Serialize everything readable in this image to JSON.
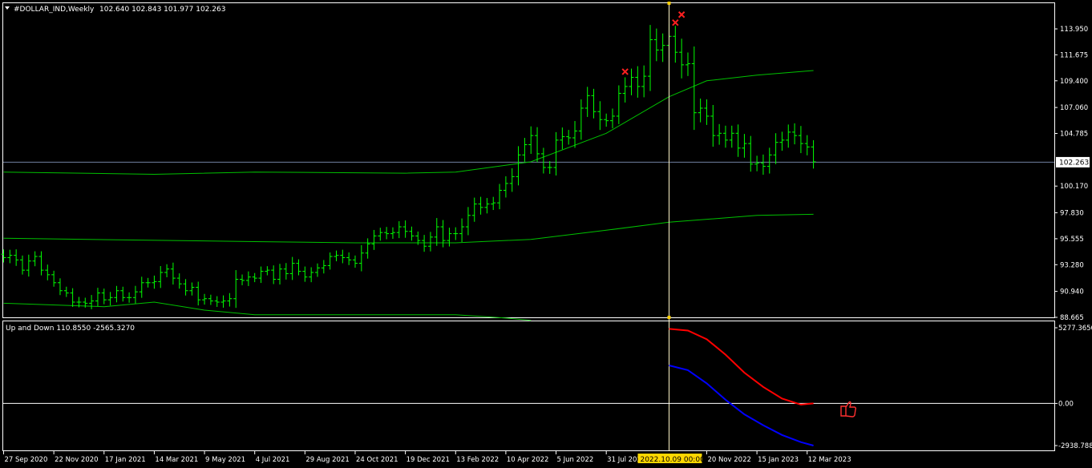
{
  "main_pane": {
    "symbol_label": "#DOLLAR_IND,Weekly",
    "ohlc_label": "102.640 102.843 101.977 102.263",
    "price_axis_labels": [
      "113.950",
      "111.675",
      "109.400",
      "107.060",
      "104.785",
      "102.263",
      "100.170",
      "97.830",
      "95.555",
      "93.280",
      "90.940",
      "88.665"
    ],
    "current_price_label": "102.263"
  },
  "indicator_pane": {
    "title": "Up and Down 110.8550 -2565.3270",
    "axis_labels": [
      "5277.3656",
      "0.00",
      "-2938.7880"
    ]
  },
  "time_axis": {
    "labels": [
      "27 Sep 2020",
      "22 Nov 2020",
      "17 Jan 2021",
      "14 Mar 2021",
      "9 May 2021",
      "4 Jul 2021",
      "29 Aug 2021",
      "24 Oct 2021",
      "19 Dec 2021",
      "13 Feb 2022",
      "10 Apr 2022",
      "5 Jun 2022",
      "31 Jul 2022",
      "20 Nov 2022",
      "15 Jan 2023",
      "12 Mar 2023"
    ],
    "crosshair_label": "2022.10.09 00:00"
  },
  "colors": {
    "background": "#000000",
    "frame": "#ffffff",
    "bars": "#00ff00",
    "bands": "#00c000",
    "up_line": "#ff0000",
    "down_line": "#0000ff",
    "crosshair": "#fff5c8",
    "signal_marker": "#ff2020",
    "price_label_bg": "#ffffff",
    "crosshair_label_bg": "#ffd700"
  },
  "chart_data": [
    {
      "type": "ohlc",
      "title": "#DOLLAR_IND,Weekly",
      "ylim": [
        88.665,
        116.2
      ],
      "x": [
        "2020-09-27",
        "2020-10-04",
        "2020-10-11",
        "2020-10-18",
        "2020-10-25",
        "2020-11-01",
        "2020-11-08",
        "2020-11-15",
        "2020-11-22",
        "2020-11-29",
        "2020-12-06",
        "2020-12-13",
        "2020-12-20",
        "2020-12-27",
        "2021-01-03",
        "2021-01-10",
        "2021-01-17",
        "2021-01-24",
        "2021-01-31",
        "2021-02-07",
        "2021-02-14",
        "2021-02-21",
        "2021-02-28",
        "2021-03-07",
        "2021-03-14",
        "2021-03-21",
        "2021-03-28",
        "2021-04-04",
        "2021-04-11",
        "2021-04-18",
        "2021-04-25",
        "2021-05-02",
        "2021-05-09",
        "2021-05-16",
        "2021-05-23",
        "2021-05-30",
        "2021-06-06",
        "2021-06-13",
        "2021-06-20",
        "2021-06-27",
        "2021-07-04",
        "2021-07-11",
        "2021-07-18",
        "2021-07-25",
        "2021-08-01",
        "2021-08-08",
        "2021-08-15",
        "2021-08-22",
        "2021-08-29",
        "2021-09-05",
        "2021-09-12",
        "2021-09-19",
        "2021-09-26",
        "2021-10-03",
        "2021-10-10",
        "2021-10-17",
        "2021-10-24",
        "2021-10-31",
        "2021-11-07",
        "2021-11-14",
        "2021-11-21",
        "2021-11-28",
        "2021-12-05",
        "2021-12-12",
        "2021-12-19",
        "2021-12-26",
        "2022-01-02",
        "2022-01-09",
        "2022-01-16",
        "2022-01-23",
        "2022-01-30",
        "2022-02-06",
        "2022-02-13",
        "2022-02-20",
        "2022-02-27",
        "2022-03-06",
        "2022-03-13",
        "2022-03-20",
        "2022-03-27",
        "2022-04-03",
        "2022-04-10",
        "2022-04-17",
        "2022-04-24",
        "2022-05-01",
        "2022-05-08",
        "2022-05-15",
        "2022-05-22",
        "2022-05-29",
        "2022-06-05",
        "2022-06-12",
        "2022-06-19",
        "2022-06-26",
        "2022-07-03",
        "2022-07-10",
        "2022-07-17",
        "2022-07-24",
        "2022-07-31",
        "2022-08-07",
        "2022-08-14",
        "2022-08-21",
        "2022-08-28",
        "2022-09-04",
        "2022-09-11",
        "2022-09-18",
        "2022-09-25",
        "2022-10-02",
        "2022-10-09",
        "2022-10-16",
        "2022-10-23",
        "2022-10-30",
        "2022-11-06",
        "2022-11-13",
        "2022-11-20",
        "2022-11-27",
        "2022-12-04",
        "2022-12-11",
        "2022-12-18",
        "2022-12-25",
        "2023-01-01",
        "2023-01-08",
        "2023-01-15",
        "2023-01-22",
        "2023-01-29",
        "2023-02-05",
        "2023-02-12",
        "2023-02-19",
        "2023-02-26",
        "2023-03-05",
        "2023-03-12",
        "2023-03-19"
      ],
      "close": [
        93.9,
        94.1,
        93.7,
        92.8,
        93.6,
        94.0,
        92.8,
        92.4,
        91.7,
        91.0,
        90.8,
        90.0,
        90.0,
        89.9,
        90.1,
        90.8,
        90.2,
        90.4,
        91.0,
        90.4,
        90.4,
        90.9,
        91.7,
        91.7,
        91.8,
        92.6,
        92.9,
        92.1,
        91.6,
        91.0,
        91.3,
        90.2,
        90.3,
        90.1,
        90.0,
        90.1,
        90.3,
        92.0,
        91.9,
        92.2,
        92.1,
        92.7,
        92.8,
        92.0,
        92.9,
        92.5,
        93.4,
        92.7,
        92.2,
        92.6,
        93.0,
        93.2,
        94.0,
        94.1,
        93.9,
        93.7,
        93.4,
        94.3,
        95.1,
        95.8,
        96.1,
        96.0,
        96.1,
        96.6,
        96.2,
        95.8,
        95.4,
        94.9,
        95.7,
        96.6,
        95.4,
        96.0,
        96.0,
        96.6,
        97.6,
        98.6,
        98.3,
        98.6,
        98.7,
        99.8,
        100.4,
        101.0,
        102.9,
        103.8,
        104.6,
        103.0,
        101.8,
        101.8,
        104.2,
        104.5,
        104.4,
        105.0,
        107.0,
        108.1,
        106.7,
        106.0,
        105.9,
        106.3,
        108.3,
        108.9,
        109.7,
        108.9,
        109.8,
        113.0,
        112.1,
        112.5,
        113.3,
        111.9,
        110.8,
        110.9,
        106.6,
        107.0,
        106.3,
        104.6,
        104.8,
        104.2,
        104.8,
        103.5,
        103.9,
        102.1,
        102.2,
        101.9,
        102.9,
        104.0,
        104.2,
        104.9,
        104.6,
        103.9,
        103.6,
        102.3
      ],
      "range": [
        1.2,
        1.4,
        1.5,
        1.1,
        1.6,
        1.3,
        1.3,
        1.4,
        1.0,
        1.1,
        1.0,
        1.2,
        1.3,
        1.1,
        1.5,
        1.3,
        1.1,
        1.4,
        1.2,
        1.0,
        1.3,
        1.5,
        1.5,
        1.2,
        1.5,
        1.6,
        1.2,
        1.6,
        1.2,
        1.2,
        1.2,
        1.4,
        1.2,
        1.0,
        1.2,
        1.4,
        1.4,
        2.3,
        1.2,
        1.4,
        1.0,
        1.2,
        1.0,
        1.2,
        1.3,
        1.5,
        1.6,
        1.0,
        1.2,
        1.3,
        1.1,
        1.4,
        1.0,
        1.2,
        1.4,
        1.3,
        1.1,
        2.0,
        1.4,
        1.5,
        1.2,
        1.4,
        1.3,
        1.4,
        1.6,
        1.2,
        1.1,
        1.4,
        1.3,
        2.2,
        1.7,
        1.5,
        1.6,
        2.1,
        2.1,
        1.6,
        1.8,
        1.5,
        1.5,
        1.6,
        1.8,
        2.1,
        2.2,
        1.7,
        2.3,
        2.1,
        1.5,
        1.6,
        2.0,
        2.3,
        1.7,
        2.5,
        2.2,
        2.2,
        1.7,
        2.6,
        1.5,
        1.9,
        2.0,
        2.3,
        2.2,
        2.8,
        2.7,
        3.7,
        2.8,
        3.0,
        3.1,
        2.6,
        3.4,
        2.8,
        4.3,
        2.4,
        2.2,
        2.8,
        2.3,
        1.9,
        1.9,
        2.2,
        2.4,
        1.9,
        1.8,
        2.1,
        1.8,
        2.3,
        2.1,
        1.9,
        2.2,
        2.4,
        2.1,
        1.7
      ],
      "band_upper": [
        {
          "x": "2020-09-27",
          "y": 101.4
        },
        {
          "x": "2021-03-14",
          "y": 101.2
        },
        {
          "x": "2021-07-04",
          "y": 101.4
        },
        {
          "x": "2021-12-19",
          "y": 101.3
        },
        {
          "x": "2022-02-13",
          "y": 101.4
        },
        {
          "x": "2022-05-08",
          "y": 102.3
        },
        {
          "x": "2022-07-31",
          "y": 104.8
        },
        {
          "x": "2022-10-09",
          "y": 108.0
        },
        {
          "x": "2022-11-20",
          "y": 109.4
        },
        {
          "x": "2023-01-15",
          "y": 109.9
        },
        {
          "x": "2023-03-19",
          "y": 110.3
        }
      ],
      "band_middle": [
        {
          "x": "2020-09-27",
          "y": 95.6
        },
        {
          "x": "2021-07-04",
          "y": 95.3
        },
        {
          "x": "2021-10-24",
          "y": 95.2
        },
        {
          "x": "2022-02-13",
          "y": 95.2
        },
        {
          "x": "2022-05-08",
          "y": 95.5
        },
        {
          "x": "2022-07-31",
          "y": 96.3
        },
        {
          "x": "2022-10-09",
          "y": 97.0
        },
        {
          "x": "2023-01-15",
          "y": 97.6
        },
        {
          "x": "2023-03-19",
          "y": 97.7
        }
      ],
      "band_lower": [
        {
          "x": "2020-09-27",
          "y": 89.9
        },
        {
          "x": "2021-01-17",
          "y": 89.6
        },
        {
          "x": "2021-03-14",
          "y": 90.0
        },
        {
          "x": "2021-05-09",
          "y": 89.3
        },
        {
          "x": "2021-07-04",
          "y": 88.9
        },
        {
          "x": "2022-02-13",
          "y": 88.9
        },
        {
          "x": "2022-04-10",
          "y": 88.6
        },
        {
          "x": "2022-05-08",
          "y": 88.4
        }
      ],
      "signals": [
        {
          "x": "2022-08-21",
          "y": 110.2
        },
        {
          "x": "2022-10-16",
          "y": 114.5
        },
        {
          "x": "2022-10-23",
          "y": 115.2
        }
      ],
      "current_price": 102.263,
      "crosshair_x": "2022-10-09"
    },
    {
      "type": "line",
      "title": "Up and Down 110.8550 -2565.3270",
      "ylim": [
        -2938.788,
        5277.3656
      ],
      "series": [
        {
          "color": "#ff0000",
          "x": [
            "2022-10-09",
            "2022-10-30",
            "2022-11-20",
            "2022-12-11",
            "2023-01-01",
            "2023-01-22",
            "2023-02-12",
            "2023-03-05",
            "2023-03-19"
          ],
          "values": [
            5200,
            5080,
            4480,
            3400,
            2150,
            1150,
            340,
            -80,
            0
          ]
        },
        {
          "color": "#0000ff",
          "x": [
            "2022-10-09",
            "2022-10-30",
            "2022-11-20",
            "2022-12-11",
            "2023-01-01",
            "2023-01-22",
            "2023-02-12",
            "2023-03-05",
            "2023-03-19"
          ],
          "values": [
            2650,
            2320,
            1400,
            250,
            -760,
            -1520,
            -2200,
            -2700,
            -2938.788
          ]
        }
      ]
    }
  ]
}
